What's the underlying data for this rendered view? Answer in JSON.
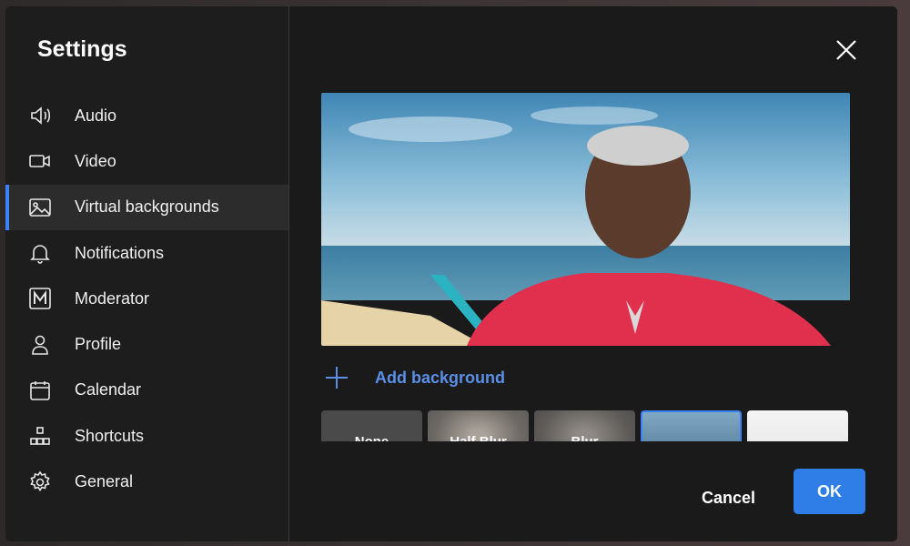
{
  "dialog": {
    "title": "Settings",
    "close_icon": "close-icon"
  },
  "sidebar": {
    "items": [
      {
        "label": "Audio",
        "icon": "speaker-icon",
        "active": false
      },
      {
        "label": "Video",
        "icon": "video-camera-icon",
        "active": false
      },
      {
        "label": "Virtual backgrounds",
        "icon": "image-icon",
        "active": true
      },
      {
        "label": "Notifications",
        "icon": "bell-icon",
        "active": false
      },
      {
        "label": "Moderator",
        "icon": "moderator-m-icon",
        "active": false
      },
      {
        "label": "Profile",
        "icon": "person-icon",
        "active": false
      },
      {
        "label": "Calendar",
        "icon": "calendar-icon",
        "active": false
      },
      {
        "label": "Shortcuts",
        "icon": "shortcuts-icon",
        "active": false
      },
      {
        "label": "General",
        "icon": "gear-icon",
        "active": false
      }
    ]
  },
  "main": {
    "add_background_label": "Add background",
    "thumbnails": [
      {
        "label": "None"
      },
      {
        "label": "Half Blur"
      },
      {
        "label": "Blur"
      },
      {
        "label": ""
      },
      {
        "label": ""
      }
    ]
  },
  "footer": {
    "cancel_label": "Cancel",
    "ok_label": "OK"
  },
  "colors": {
    "accent": "#2f7ee8",
    "link": "#5b8fe6",
    "dialog_bg": "#1a1a1a",
    "active_item_bg": "#2c2c2c"
  }
}
